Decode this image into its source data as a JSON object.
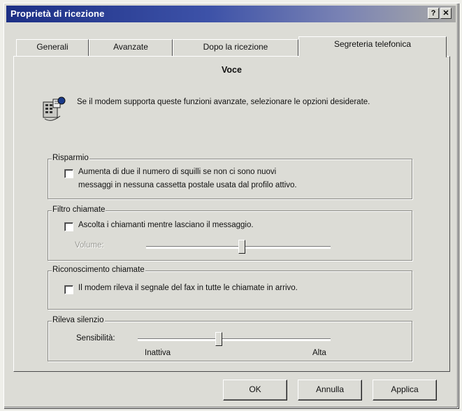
{
  "window": {
    "title": "Proprietà di ricezione",
    "help_glyph": "?",
    "close_glyph": "✕"
  },
  "tabs": [
    {
      "label": "Generali"
    },
    {
      "label": "Avanzate"
    },
    {
      "label": "Dopo la ricezione"
    },
    {
      "label": "Segreteria telefonica",
      "selected": true
    }
  ],
  "panel": {
    "heading": "Voce",
    "intro": "Se il modem supporta queste funzioni avanzate, selezionare le opzioni desiderate.",
    "risparmio": {
      "label": "Risparmio",
      "checkbox_line1": "Aumenta di due il numero di squilli se non ci sono nuovi",
      "checkbox_line2": "messaggi in nessuna cassetta postale usata dal profilo attivo.",
      "checked": false
    },
    "filtro": {
      "label": "Filtro chiamate",
      "checkbox": "Ascolta i chiamanti mentre lasciano il messaggio.",
      "checked": false,
      "volume_label": "Volume:",
      "volume_level": 0.52
    },
    "riconoscimento": {
      "label": "Riconoscimento chiamate",
      "checkbox": "Il modem rileva il segnale del fax in tutte le chiamate in arrivo.",
      "checked": false
    },
    "silenzio": {
      "label": "Rileva silenzio",
      "sensibilita_label": "Sensibilità:",
      "min_label": "Inattiva",
      "max_label": "Alta",
      "level": 0.42
    }
  },
  "buttons": {
    "ok": "OK",
    "cancel": "Annulla",
    "apply": "Applica"
  }
}
